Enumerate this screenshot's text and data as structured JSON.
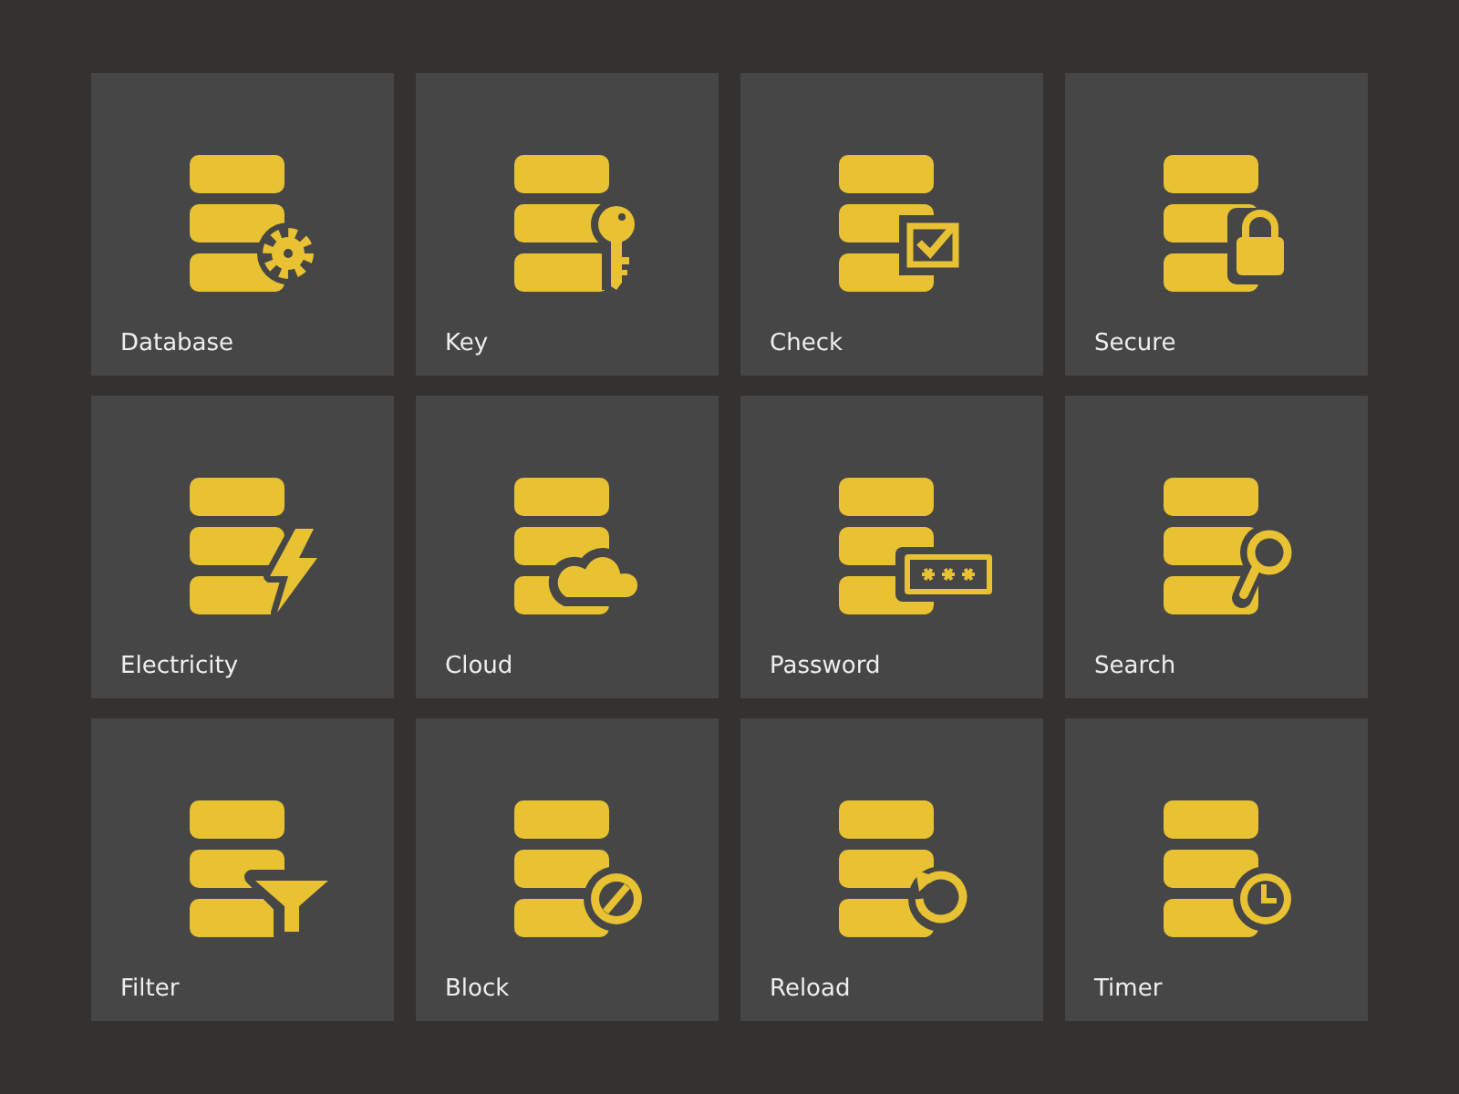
{
  "tiles": [
    {
      "label": "Database",
      "kind": "gear"
    },
    {
      "label": "Key",
      "kind": "key"
    },
    {
      "label": "Check",
      "kind": "check"
    },
    {
      "label": "Secure",
      "kind": "lock"
    },
    {
      "label": "Electricity",
      "kind": "bolt"
    },
    {
      "label": "Cloud",
      "kind": "cloud"
    },
    {
      "label": "Password",
      "kind": "password"
    },
    {
      "label": "Search",
      "kind": "magnifier"
    },
    {
      "label": "Filter",
      "kind": "filter"
    },
    {
      "label": "Block",
      "kind": "block"
    },
    {
      "label": "Reload",
      "kind": "reload"
    },
    {
      "label": "Timer",
      "kind": "clock"
    }
  ]
}
